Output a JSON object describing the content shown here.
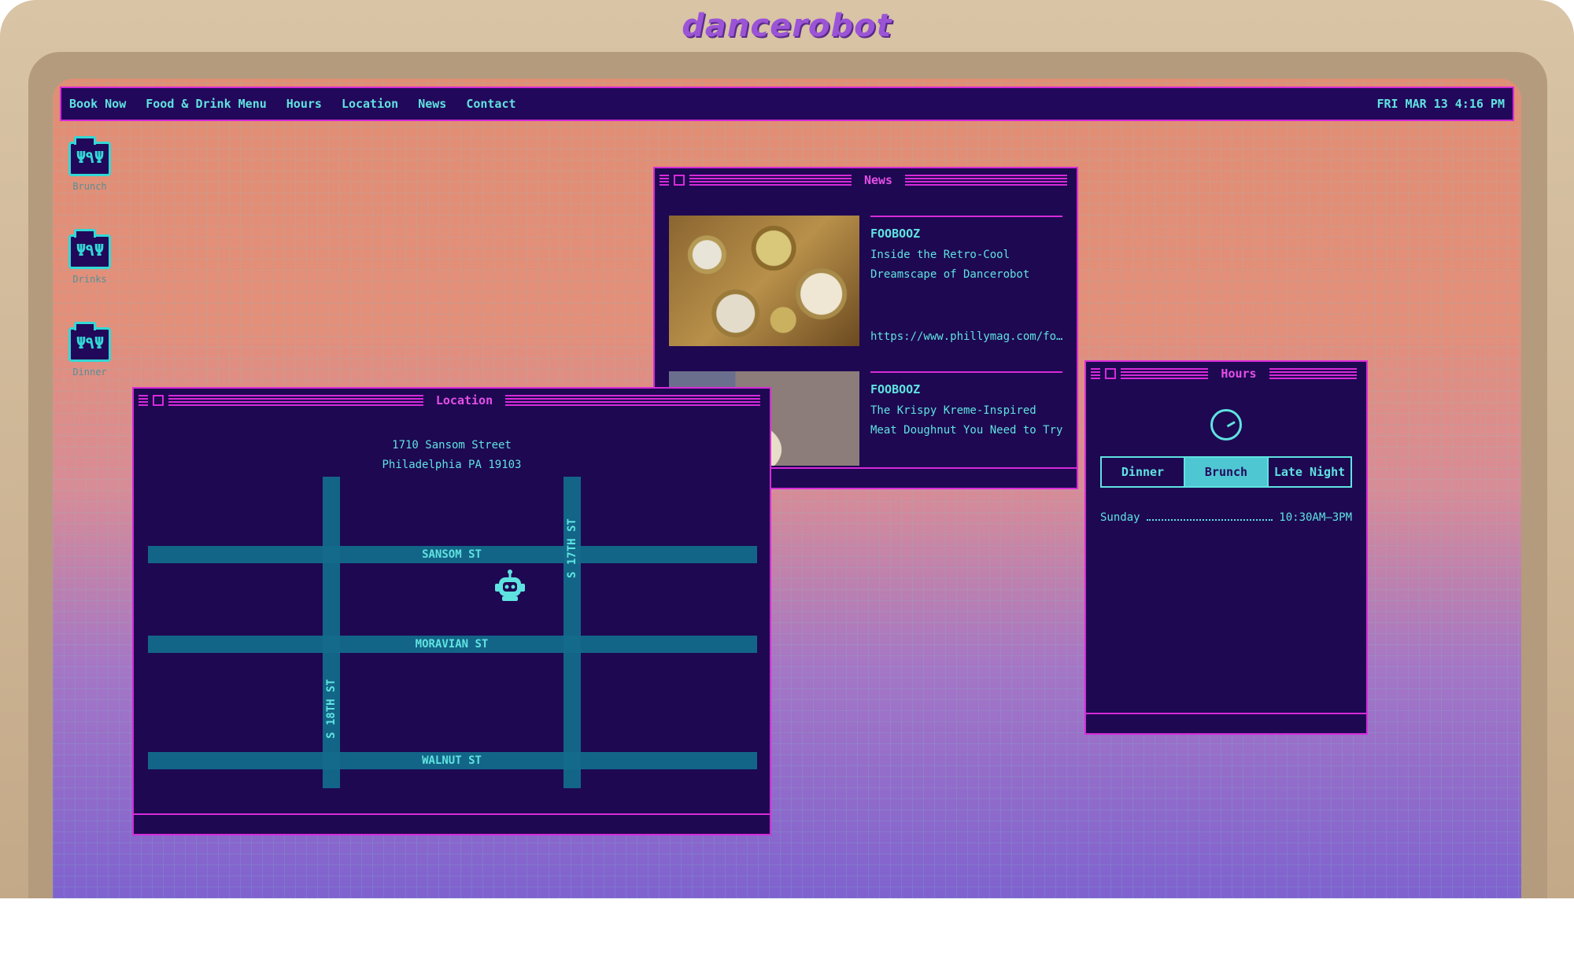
{
  "brand": "dancerobot",
  "menubar": {
    "items": [
      "Book Now",
      "Food & Drink Menu",
      "Hours",
      "Location",
      "News",
      "Contact"
    ],
    "clock": "FRI MAR 13 4:16 PM"
  },
  "desktop_icons": [
    {
      "label": "Brunch",
      "icon": "utensils-folder-icon"
    },
    {
      "label": "Drinks",
      "icon": "utensils-folder-icon"
    },
    {
      "label": "Dinner",
      "icon": "utensils-folder-icon"
    }
  ],
  "news": {
    "title": "News",
    "items": [
      {
        "source": "FOOBOOZ",
        "headline": "Inside the Retro-Cool Dreamscape of Dancerobot",
        "link": "https://www.phillymag.com/foobooz/"
      },
      {
        "source": "FOOBOOZ",
        "headline": "The Krispy Kreme-Inspired Meat Doughnut You Need to Try"
      }
    ]
  },
  "location": {
    "title": "Location",
    "address_line1": "1710 Sansom Street",
    "address_line2": "Philadelphia PA 19103",
    "streets": {
      "sansom": "SANSOM ST",
      "moravian": "MORAVIAN ST",
      "walnut": "WALNUT ST",
      "s17th": "S 17TH ST",
      "s18th": "S 18TH ST"
    }
  },
  "hours": {
    "title": "Hours",
    "tabs": [
      "Dinner",
      "Brunch",
      "Late Night"
    ],
    "active_tab": "Brunch",
    "rows": [
      {
        "day": "Sunday",
        "time": "10:30AM—3PM"
      }
    ]
  },
  "colors": {
    "accent_magenta": "#d62bd8",
    "accent_cyan": "#5fe3e0",
    "window_bg": "#1e0852"
  }
}
